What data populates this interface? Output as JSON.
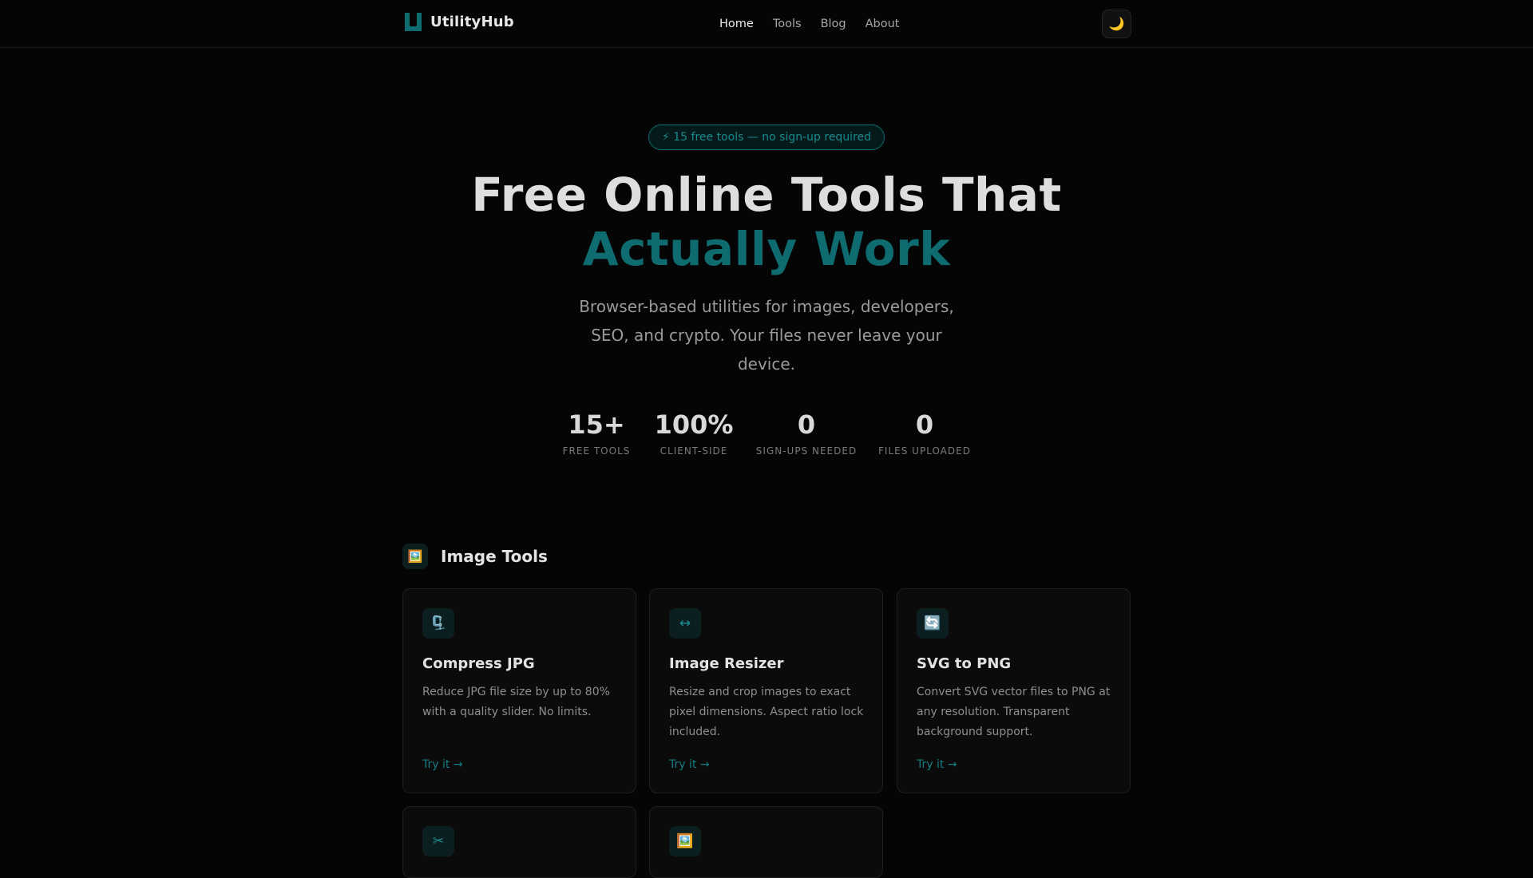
{
  "brand": {
    "name": "UtilityHub",
    "accent": "#0e6b70"
  },
  "nav": {
    "items": [
      {
        "label": "Home",
        "active": true
      },
      {
        "label": "Tools",
        "active": false
      },
      {
        "label": "Blog",
        "active": false
      },
      {
        "label": "About",
        "active": false
      }
    ],
    "theme_toggle_icon": "🌙"
  },
  "hero": {
    "badge": "⚡ 15 free tools — no sign-up required",
    "title_line1": "Free Online Tools That",
    "title_line2": "Actually Work",
    "subtitle": "Browser-based utilities for images, developers, SEO, and crypto. Your files never leave your device."
  },
  "stats": [
    {
      "value": "15+",
      "label": "FREE TOOLS"
    },
    {
      "value": "100%",
      "label": "CLIENT-SIDE"
    },
    {
      "value": "0",
      "label": "SIGN-UPS NEEDED"
    },
    {
      "value": "0",
      "label": "FILES UPLOADED"
    }
  ],
  "section": {
    "icon": "🖼️",
    "title": "Image Tools"
  },
  "cards": [
    {
      "icon": "🗜️",
      "title": "Compress JPG",
      "desc": "Reduce JPG file size by up to 80% with a quality slider. No limits.",
      "link": "Try it →"
    },
    {
      "icon": "↔",
      "title": "Image Resizer",
      "desc": "Resize and crop images to exact pixel dimensions. Aspect ratio lock included.",
      "link": "Try it →"
    },
    {
      "icon": "🔄",
      "title": "SVG to PNG",
      "desc": "Convert SVG vector files to PNG at any resolution. Transparent background support.",
      "link": "Try it →"
    },
    {
      "icon": "✂",
      "title": "",
      "desc": "",
      "link": ""
    },
    {
      "icon": "🖼️",
      "title": "",
      "desc": "",
      "link": ""
    }
  ]
}
